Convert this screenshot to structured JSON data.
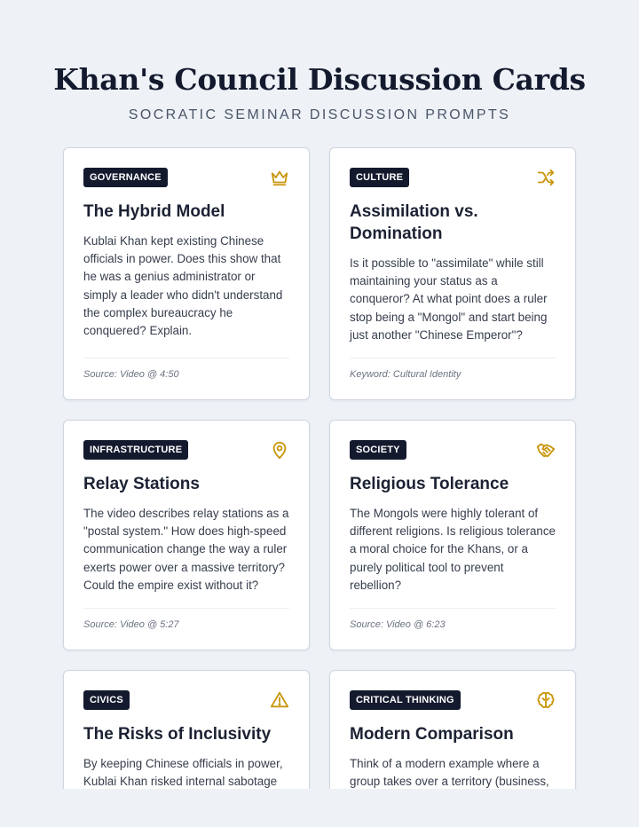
{
  "header": {
    "title": "Khan's Council Discussion Cards",
    "subtitle": "SOCRATIC SEMINAR DISCUSSION PROMPTS"
  },
  "colors": {
    "tag_bg": "#141a2e",
    "icon_gold": "#c9960c",
    "page_bg": "#eef2f7"
  },
  "cards": [
    {
      "tag": "GOVERNANCE",
      "icon": "crown-icon",
      "title": "The Hybrid Model",
      "body": "Kublai Khan kept existing Chinese officials in power. Does this show that he was a genius administrator or simply a leader who didn't understand the complex bureaucracy he conquered? Explain.",
      "footer": "Source: Video @ 4:50"
    },
    {
      "tag": "CULTURE",
      "icon": "shuffle-icon",
      "title": "Assimilation vs. Domination",
      "body": "Is it possible to \"assimilate\" while still maintaining your status as a conqueror? At what point does a ruler stop being a \"Mongol\" and start being just another \"Chinese Emperor\"?",
      "footer": "Keyword: Cultural Identity"
    },
    {
      "tag": "INFRASTRUCTURE",
      "icon": "map-pin-icon",
      "title": "Relay Stations",
      "body": "The video describes relay stations as a \"postal system.\" How does high-speed communication change the way a ruler exerts power over a massive territory? Could the empire exist without it?",
      "footer": "Source: Video @ 5:27"
    },
    {
      "tag": "SOCIETY",
      "icon": "handshake-icon",
      "title": "Religious Tolerance",
      "body": "The Mongols were highly tolerant of different religions. Is religious tolerance a moral choice for the Khans, or a purely political tool to prevent rebellion?",
      "footer": "Source: Video @ 6:23"
    },
    {
      "tag": "CIVICS",
      "icon": "warning-icon",
      "title": "The Risks of Inclusivity",
      "body": "By keeping Chinese officials in power, Kublai Khan risked internal sabotage",
      "footer": ""
    },
    {
      "tag": "CRITICAL THINKING",
      "icon": "brain-icon",
      "title": "Modern Comparison",
      "body": "Think of a modern example where a group takes over a territory (business,",
      "footer": ""
    }
  ]
}
